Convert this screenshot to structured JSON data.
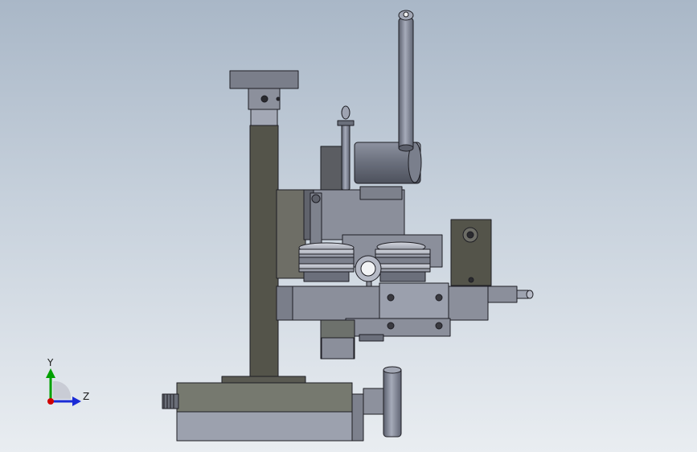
{
  "triad": {
    "y_label": "Y",
    "z_label": "Z",
    "colors": {
      "y": "#00a000",
      "z": "#1a2bd6",
      "x": "#d00000"
    }
  },
  "model": {
    "colors": {
      "dark_steel": "#54544a",
      "mid_steel": "#787c86",
      "light_steel": "#9a9fae",
      "edge": "#1e1e24"
    }
  }
}
